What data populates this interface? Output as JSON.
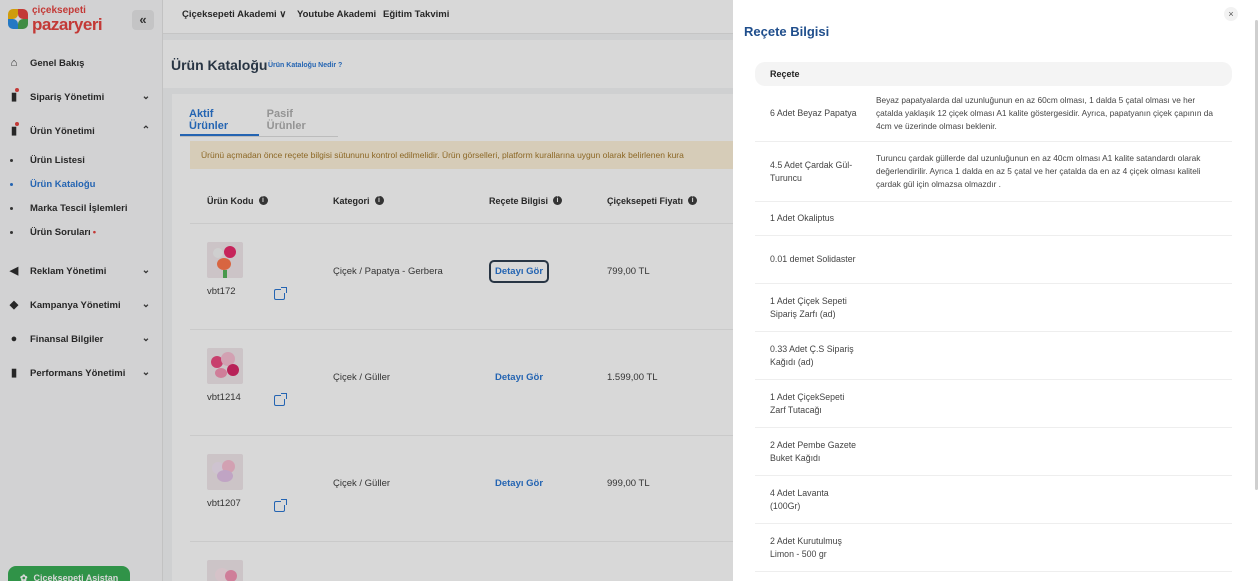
{
  "brand": {
    "top": "çiçeksepeti",
    "bottom": "pazaryeri"
  },
  "topbar": {
    "links": [
      "Çiçeksepeti Akademi ∨",
      "Youtube Akademi",
      "Eğitim Takvimi"
    ]
  },
  "sidebar": {
    "items": [
      {
        "label": "Genel Bakış"
      },
      {
        "label": "Sipariş Yönetimi"
      },
      {
        "label": "Ürün Yönetimi"
      },
      {
        "label": "Reklam Yönetimi"
      },
      {
        "label": "Kampanya Yönetimi"
      },
      {
        "label": "Finansal Bilgiler"
      },
      {
        "label": "Performans Yönetimi"
      }
    ],
    "subitems": [
      {
        "label": "Ürün Listesi"
      },
      {
        "label": "Ürün Kataloğu"
      },
      {
        "label": "Marka Tescil İşlemleri"
      },
      {
        "label": "Ürün Soruları"
      }
    ],
    "assistant": "Çiçeksepeti Asistan"
  },
  "page": {
    "title": "Ürün Kataloğu",
    "help": "Ürün Kataloğu Nedir ?"
  },
  "tabs": [
    "Aktif Ürünler",
    "Pasif Ürünler"
  ],
  "warning": "Ürünü açmadan önce reçete bilgisi sütununu kontrol edilmelidir. Ürün görselleri, platform kurallarına uygun olarak belirlenen kura",
  "table": {
    "headers": [
      "Ürün Kodu",
      "Kategori",
      "Reçete Bilgisi",
      "Çiçeksepeti Fiyatı"
    ],
    "rows": [
      {
        "code": "vbt172",
        "category": "Çiçek / Papatya - Gerbera",
        "detail": "Detayı Gör",
        "price": "799,00 TL"
      },
      {
        "code": "vbt1214",
        "category": "Çiçek / Güller",
        "detail": "Detayı Gör",
        "price": "1.599,00 TL"
      },
      {
        "code": "vbt1207",
        "category": "Çiçek / Güller",
        "detail": "Detayı Gör",
        "price": "999,00 TL"
      }
    ]
  },
  "drawer": {
    "title": "Reçete Bilgisi",
    "close": "×",
    "header": "Reçete",
    "rows": [
      {
        "name": "6 Adet Beyaz Papatya",
        "desc": "Beyaz papatyalarda dal uzunluğunun en az 60cm olması, 1 dalda 5 çatal olması ve her çatalda yaklaşık 12 çiçek olması A1 kalite göstergesidir. Ayrıca, papatyanın çiçek çapının da 4cm ve üzerinde olması beklenir."
      },
      {
        "name": "4.5 Adet Çardak Gül-Turuncu",
        "desc": "Turuncu çardak güllerde dal uzunluğunun en az 40cm olması A1 kalite satandardı olarak değerlendirilir. Ayrıca 1 dalda en az 5 çatal ve her çatalda da en az 4 çiçek olması kaliteli çardak gül için olmazsa olmazdır ."
      },
      {
        "name": "1 Adet Okaliptus",
        "desc": ""
      },
      {
        "name": "0.01 demet Solidaster",
        "desc": ""
      },
      {
        "name": "1 Adet Çiçek Sepeti Sipariş Zarfı (ad)",
        "desc": ""
      },
      {
        "name": "0.33 Adet Ç.S Sipariş Kağıdı (ad)",
        "desc": ""
      },
      {
        "name": "1 Adet ÇiçekSepeti Zarf Tutacağı",
        "desc": ""
      },
      {
        "name": "2 Adet Pembe Gazete Buket Kağıdı",
        "desc": ""
      },
      {
        "name": "4 Adet Lavanta (100Gr)",
        "desc": ""
      },
      {
        "name": "2 Adet Kurutulmuş Limon - 500 gr",
        "desc": ""
      }
    ]
  }
}
